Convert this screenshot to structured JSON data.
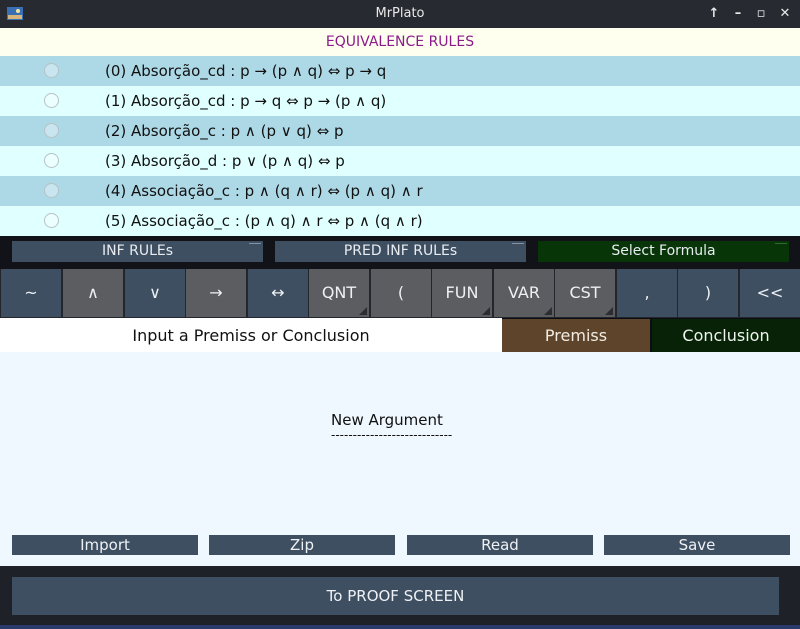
{
  "window": {
    "title": "MrPlato"
  },
  "header": {
    "title": "EQUIVALENCE RULES"
  },
  "rules": [
    "(0) Absorção_cd : p → (p ∧ q) ⇔ p → q",
    "(1) Absorção_cd : p → q ⇔ p → (p ∧ q)",
    "(2) Absorção_c : p ∧ (p ∨ q) ⇔ p",
    "(3) Absorção_d : p ∨ (p ∧ q) ⇔ p",
    "(4) Associação_c : p ∧ (q ∧ r) ⇔ (p ∧ q) ∧ r",
    "(5) Associação_c : (p ∧ q) ∧ r ⇔ p ∧ (q ∧ r)"
  ],
  "tabs": {
    "inf_rules": "INF RULEs",
    "pred_inf_rules": "PRED INF RULEs",
    "select_formula": "Select Formula"
  },
  "keys": [
    "~",
    "∧",
    "∨",
    "→",
    "↔",
    "QNT",
    "(",
    "FUN",
    "VAR",
    "CST",
    ",",
    ")",
    "<<"
  ],
  "input": {
    "label": "Input a Premiss or Conclusion",
    "premiss": "Premiss",
    "conclusion": "Conclusion"
  },
  "argument": {
    "title": "New Argument",
    "underline": "----------------------------"
  },
  "actions": {
    "import": "Import",
    "zip": "Zip",
    "read": "Read",
    "save": "Save"
  },
  "proof_button": "To PROOF SCREEN",
  "colors": {
    "accent_blue": "#3f4f62",
    "premiss": "#5e442a",
    "conclusion": "#072207",
    "header_text": "#8b1a8b"
  }
}
